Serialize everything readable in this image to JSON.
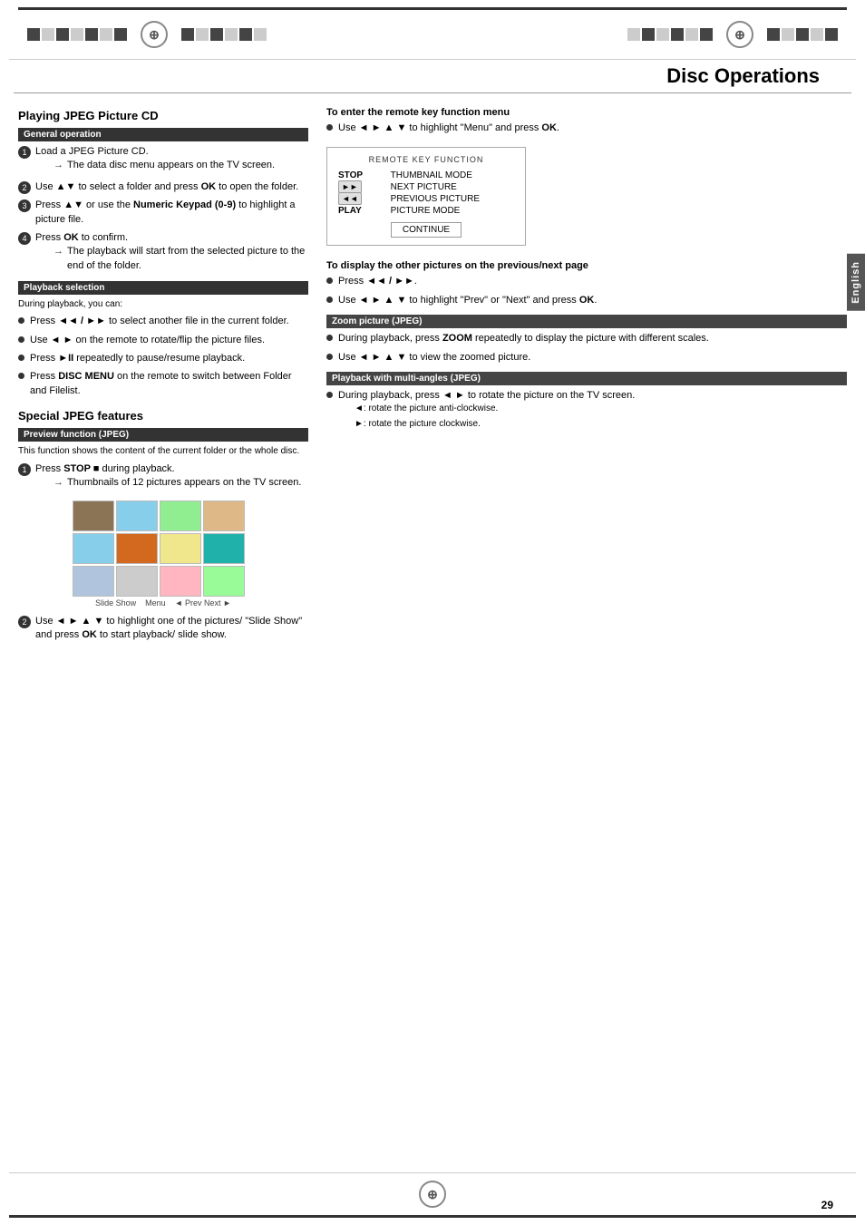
{
  "page": {
    "title": "Disc Operations",
    "number": "29",
    "language_tab": "English"
  },
  "header": {
    "compass_symbol": "⊕",
    "checker_pattern": [
      "dark",
      "light",
      "dark",
      "light",
      "dark",
      "light",
      "dark",
      "dark",
      "light",
      "dark",
      "light",
      "dark"
    ]
  },
  "left_column": {
    "section_title": "Playing JPEG Picture CD",
    "general_operation_label": "General operation",
    "steps": [
      {
        "num": "1",
        "text": "Load a JPEG Picture CD.",
        "arrow": "The data disc menu appears on the TV screen."
      },
      {
        "num": "2",
        "text_start": "Use ",
        "text_bold1": "▲▼",
        "text_mid": " to select a folder and press ",
        "text_bold2": "OK",
        "text_end": " to open the folder.",
        "arrow": null
      },
      {
        "num": "3",
        "text_start": "Press ",
        "text_bold1": "▲▼",
        "text_mid": " or use the ",
        "text_bold2": "Numeric Keypad (0-9)",
        "text_end": " to highlight a picture file.",
        "arrow": null
      },
      {
        "num": "4",
        "text_start": "Press ",
        "text_bold1": "OK",
        "text_end": " to confirm.",
        "arrow": "The playback will start from the selected picture to the end of the folder."
      }
    ],
    "playback_selection_label": "Playback selection",
    "playback_selection_intro": "During playback, you can:",
    "playback_bullets": [
      {
        "text_start": "Press ",
        "text_bold": "◄◄ / ►► ",
        "text_end": "to select another file in the current folder."
      },
      {
        "text_start": "Use ",
        "text_bold": "◄ ►",
        "text_end": " on the remote to rotate/flip the picture files."
      },
      {
        "text_start": "Press ",
        "text_bold": "►II",
        "text_end": " repeatedly to pause/resume playback."
      },
      {
        "text_start": "Press ",
        "text_bold": "DISC MENU",
        "text_end": " on the remote to switch between Folder and Filelist."
      }
    ],
    "special_section_title": "Special JPEG features",
    "preview_label": "Preview function (JPEG)",
    "preview_text": "This function shows the content of the current folder or the whole disc.",
    "preview_step1_text_start": "Press ",
    "preview_step1_bold1": "STOP",
    "preview_step1_bold1_sym": "■",
    "preview_step1_text_end": " during playback.",
    "preview_step1_arrow": "Thumbnails of 12 pictures appears on the TV screen.",
    "thumb_nav": {
      "slide_show": "Slide Show",
      "menu": "Menu",
      "prev_next": "◄ Prev  Next ►"
    },
    "preview_step2_text_start": "Use ",
    "preview_step2_bold1": "◄ ► ▲ ▼",
    "preview_step2_text_mid": " to highlight one of the pictures/ \"Slide Show\" and press ",
    "preview_step2_bold2": "OK",
    "preview_step2_text_end": " to start playback/ slide show."
  },
  "right_column": {
    "remote_menu_title": "To enter the remote key function menu",
    "remote_menu_text_start": "Use ",
    "remote_menu_bold": "◄ ► ▲ ▼",
    "remote_menu_text_end": " to highlight \"Menu\" and press OK.",
    "remote_key_function_label": "REMOTE KEY FUNCTION",
    "remote_keys": [
      {
        "key": "STOP",
        "function": "THUMBNAIL MODE"
      },
      {
        "key": "►► ",
        "function": "NEXT PICTURE"
      },
      {
        "key": "◄◄ ",
        "function": "PREVIOUS PICTURE"
      },
      {
        "key": "PLAY",
        "function": "PICTURE MODE"
      }
    ],
    "continue_btn": "CONTINUE",
    "other_pictures_title": "To display the other pictures on the previous/next page",
    "other_bullets": [
      {
        "text_start": "Press ",
        "text_bold": "◄◄ / ►►",
        "text_end": "."
      },
      {
        "text_start": "Use ",
        "text_bold": "◄ ► ▲ ▼",
        "text_end": " to highlight \"Prev\" or \"Next\" and press OK."
      }
    ],
    "zoom_label": "Zoom picture (JPEG)",
    "zoom_bullets": [
      {
        "text_start": "During playback, press ",
        "text_bold": "ZOOM",
        "text_end": " repeatedly to display the picture with different scales."
      },
      {
        "text_start": "Use ",
        "text_bold": "◄ ► ▲ ▼",
        "text_end": " to view the zoomed picture."
      }
    ],
    "multiangle_label": "Playback with multi-angles (JPEG)",
    "multiangle_bullets": [
      {
        "text_start": "During playback, press ",
        "text_bold": "◄ ►",
        "text_end": " to rotate the picture on the TV screen."
      }
    ],
    "multiangle_sub": [
      "◄: rotate the picture anti-clockwise.",
      "►: rotate the picture clockwise."
    ]
  }
}
